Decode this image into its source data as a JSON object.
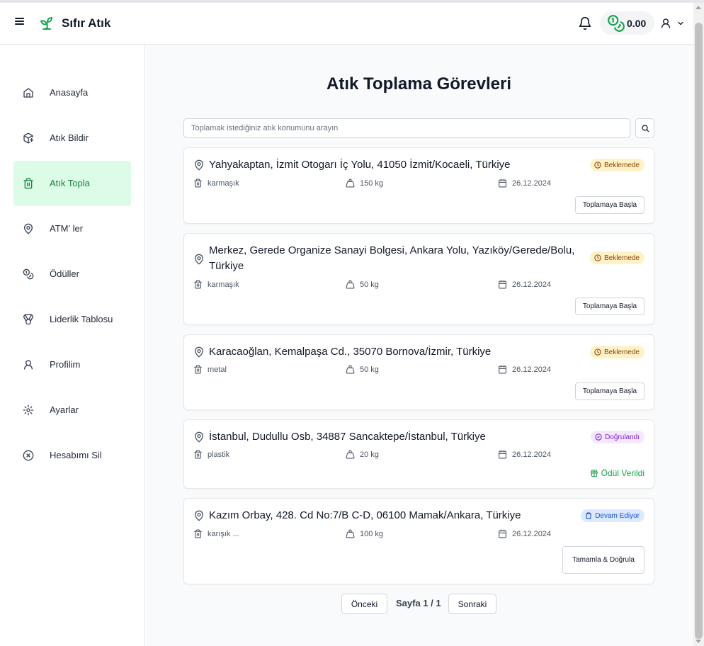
{
  "app": {
    "brand": "Sıfır Atık",
    "balance": "0.00"
  },
  "sidebar": {
    "items": [
      {
        "label": "Anasayfa",
        "icon": "home-icon"
      },
      {
        "label": "Atık Bildir",
        "icon": "box-add-icon"
      },
      {
        "label": "Atık Topla",
        "icon": "trash-icon",
        "active": true
      },
      {
        "label": "ATM' ler",
        "icon": "map-pin-icon"
      },
      {
        "label": "Ödüller",
        "icon": "coins-icon"
      },
      {
        "label": "Liderlik Tablosu",
        "icon": "medal-icon"
      },
      {
        "label": "Profilim",
        "icon": "user-icon"
      },
      {
        "label": "Ayarlar",
        "icon": "gear-icon"
      },
      {
        "label": "Hesabımı Sil",
        "icon": "circle-x-icon"
      }
    ]
  },
  "main": {
    "title": "Atık Toplama Görevleri",
    "search": {
      "placeholder": "Toplamak istediğiniz atık konumunu arayın",
      "value": ""
    },
    "tasks": [
      {
        "address": "Yahyakaptan, İzmit Otogarı İç Yolu, 41050 İzmit/Kocaeli, Türkiye",
        "status": "Beklemede",
        "status_type": "pending",
        "waste_type": "karmaşık",
        "weight": "150 kg",
        "date": "26.12.2024",
        "action": "Toplamaya Başla"
      },
      {
        "address": "Merkez, Gerede Organize Sanayi Bolgesi, Ankara Yolu, Yazıköy/Gerede/Bolu, Türkiye",
        "status": "Beklemede",
        "status_type": "pending",
        "waste_type": "karmaşık",
        "weight": "50 kg",
        "date": "26.12.2024",
        "action": "Toplamaya Başla"
      },
      {
        "address": "Karacaoğlan, Kemalpaşa Cd., 35070 Bornova/İzmir, Türkiye",
        "status": "Beklemede",
        "status_type": "pending",
        "waste_type": "metal",
        "weight": "50 kg",
        "date": "26.12.2024",
        "action": "Toplamaya Başla"
      },
      {
        "address": "İstanbul, Dudullu Osb, 34887 Sancaktepe/İstanbul, Türkiye",
        "status": "Doğrulandı",
        "status_type": "verified",
        "waste_type": "plastik",
        "weight": "20 kg",
        "date": "26.12.2024",
        "reward": "Ödül Verildi"
      },
      {
        "address": "Kazım Orbay, 428. Cd No:7/B C-D, 06100 Mamak/Ankara, Türkiye",
        "status": "Devam Ediyor",
        "status_type": "progress",
        "waste_type": "karışık ...",
        "weight": "100 kg",
        "date": "26.12.2024",
        "action": "Tamamla & Doğrula"
      }
    ],
    "pagination": {
      "prev": "Önceki",
      "page_text": "Sayfa 1 / 1",
      "next": "Sonraki"
    }
  },
  "colors": {
    "accent_green": "#16a34a",
    "active_bg": "#dcfce7",
    "pending_bg": "#fef3c7",
    "verified_bg": "#f3e8ff",
    "progress_bg": "#dbeafe"
  }
}
